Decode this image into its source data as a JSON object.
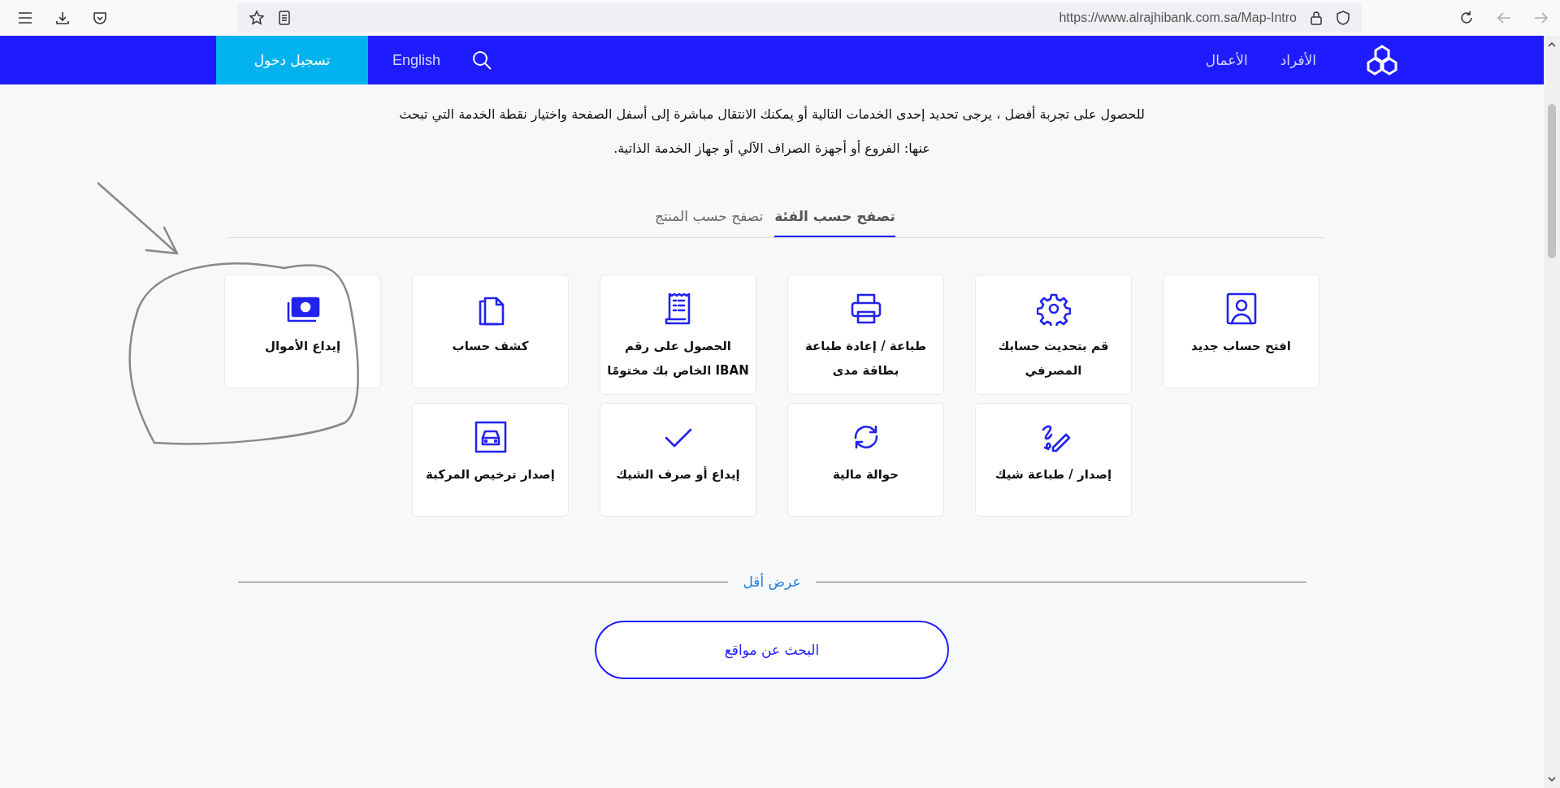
{
  "browser": {
    "address": "https://www.alrajhibank.com.sa/Map-Intro"
  },
  "nav": {
    "login": "تسجيل دخول",
    "language": "English",
    "links": [
      "الأفراد",
      "الأعمال"
    ]
  },
  "intro": "للحصول على تجربة أفضل ، يرجى تحديد إحدى الخدمات التالية أو يمكنك الانتقال مباشرة إلى أسفل الصفحة واختيار نقطة الخدمة التي تبحث عنها: الفروع أو أجهزة الصراف الآلي أو جهاز الخدمة الذاتية.",
  "tabs": [
    {
      "label": "تصفح حسب الفئة",
      "selected": true
    },
    {
      "label": "تصفح حسب المنتج",
      "selected": false
    }
  ],
  "card_rows": [
    [
      {
        "label": "افتح حساب جديد"
      },
      {
        "label": "قم بتحديث حسابك المصرفي"
      },
      {
        "label": "طباعة / إعادة طباعة بطاقة مدى"
      },
      {
        "label": "الحصول على رقم IBAN الخاص بك مختومًا"
      },
      {
        "label": "كشف حساب"
      },
      {
        "label": "إيداع الأموال"
      }
    ],
    [
      {
        "label": "إصدار / طباعة شيك"
      },
      {
        "label": "حوالة مالية"
      },
      {
        "label": "إيداع أو صرف الشيك"
      },
      {
        "label": "إصدار ترخيص المركبة"
      }
    ]
  ],
  "show_less": "عرض أقل",
  "search_button": "البحث عن مواقع"
}
